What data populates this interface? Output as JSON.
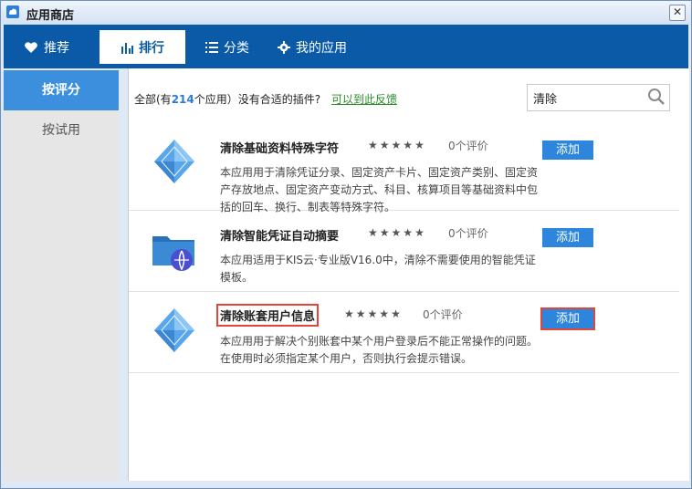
{
  "window": {
    "title": "应用商店",
    "close_label": "✕"
  },
  "nav": {
    "tabs": [
      {
        "label": "推荐",
        "icon": "heart-icon"
      },
      {
        "label": "排行",
        "icon": "bar-chart-icon"
      },
      {
        "label": "分类",
        "icon": "list-icon"
      },
      {
        "label": "我的应用",
        "icon": "gear-icon"
      }
    ]
  },
  "sidebar": {
    "items": [
      {
        "label": "按评分"
      },
      {
        "label": "按试用"
      }
    ]
  },
  "main": {
    "topline": {
      "prefix": "全部(有",
      "count": "214",
      "suffix": "个应用）没有合适的插件?",
      "link": "可以到此反馈"
    },
    "search": {
      "value": "清除",
      "placeholder": ""
    },
    "apps": [
      {
        "name": "清除基础资料特殊字符",
        "rating": "0个评价",
        "add_label": "添加",
        "desc": "本应用用于清除凭证分录、固定资产卡片、固定资产类别、固定资产存放地点、固定资产变动方式、科目、核算项目等基础资料中包括的回车、换行、制表等特殊字符。",
        "icon": "diamond-icon"
      },
      {
        "name": "清除智能凭证自动摘要",
        "rating": "0个评价",
        "add_label": "添加",
        "desc": "本应用适用于KIS云·专业版V16.0中，清除不需要使用的智能凭证模板。",
        "icon": "folder-icon"
      },
      {
        "name": "清除账套用户信息",
        "rating": "0个评价",
        "add_label": "添加",
        "desc": "本应用用于解决个别账套中某个用户登录后不能正常操作的问题。在使用时必须指定某个用户，否则执行会提示错误。",
        "icon": "diamond-icon"
      }
    ]
  },
  "colors": {
    "nav_bg": "#0a5aa8",
    "accent": "#2d86db",
    "highlight_box": "#e0463a",
    "sidebar_active": "#3b8fdc",
    "link": "#2a8a2a"
  }
}
